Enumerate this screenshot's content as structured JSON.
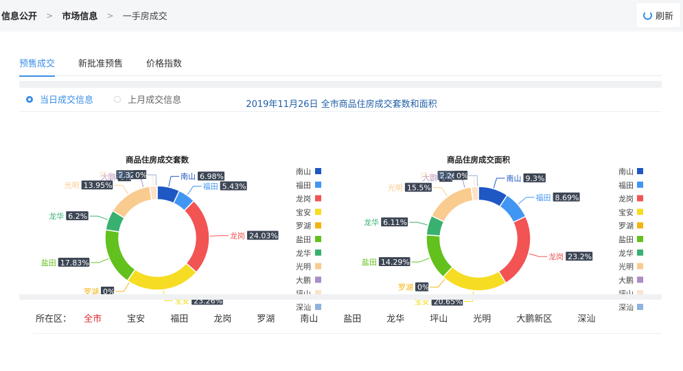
{
  "breadcrumb": {
    "items": [
      "信息公开",
      "市场信息",
      "一手房成交"
    ],
    "separator": ">"
  },
  "refresh": {
    "label": "刷新"
  },
  "tabs": [
    {
      "label": "预售成交",
      "active": true
    },
    {
      "label": "新批准预售",
      "active": false
    },
    {
      "label": "价格指数",
      "active": false
    }
  ],
  "radios": [
    {
      "label": "当日成交信息",
      "checked": true
    },
    {
      "label": "上月成交信息",
      "checked": false
    }
  ],
  "main_title": "2019年11月26日 全市商品住房成交套数和面积",
  "legend_items": [
    "南山",
    "福田",
    "龙岗",
    "宝安",
    "罗湖",
    "盐田",
    "龙华",
    "光明",
    "大鹏",
    "坪山",
    "深汕"
  ],
  "colors": {
    "南山": "#1f57c3",
    "福田": "#4196f2",
    "龙岗": "#f25353",
    "宝安": "#f6dc23",
    "罗湖": "#f3b412",
    "盐田": "#62c11c",
    "龙华": "#38b06f",
    "光明": "#f9cb8f",
    "大鹏": "#a98dc8",
    "坪山": "#fbe2c8",
    "深汕": "#8fb3dd"
  },
  "chart_data": [
    {
      "type": "pie",
      "title": "商品住房成交套数",
      "categories": [
        "南山",
        "福田",
        "龙岗",
        "宝安",
        "罗湖",
        "盐田",
        "龙华",
        "光明",
        "大鹏",
        "坪山",
        "深汕"
      ],
      "values": [
        6.98,
        5.43,
        24.03,
        23.26,
        0,
        17.83,
        6.2,
        13.95,
        0,
        2.32,
        0
      ],
      "labels": [
        "6.98%",
        "5.43%",
        "24.03%",
        "23.26%",
        "0%",
        "17.83%",
        "6.2%",
        "13.95%",
        "0%",
        "2.32%",
        "0%"
      ],
      "legend_position": "right"
    },
    {
      "type": "pie",
      "title": "商品住房成交面积",
      "categories": [
        "南山",
        "福田",
        "龙岗",
        "宝安",
        "罗湖",
        "盐田",
        "龙华",
        "光明",
        "大鹏",
        "坪山",
        "深汕"
      ],
      "values": [
        9.3,
        8.69,
        23.2,
        20.65,
        0,
        14.29,
        6.11,
        15.5,
        0,
        2.26,
        0
      ],
      "labels": [
        "9.3%",
        "8.69%",
        "23.2%",
        "20.65%",
        "0%",
        "14.29%",
        "6.11%",
        "15.5%",
        "0%",
        "2.26%",
        "0%"
      ],
      "legend_position": "right"
    }
  ],
  "district_filter": {
    "label": "所在区：",
    "items": [
      "全市",
      "宝安",
      "福田",
      "龙岗",
      "罗湖",
      "南山",
      "盐田",
      "龙华",
      "坪山",
      "光明",
      "大鹏新区",
      "深汕"
    ],
    "active": "全市"
  }
}
